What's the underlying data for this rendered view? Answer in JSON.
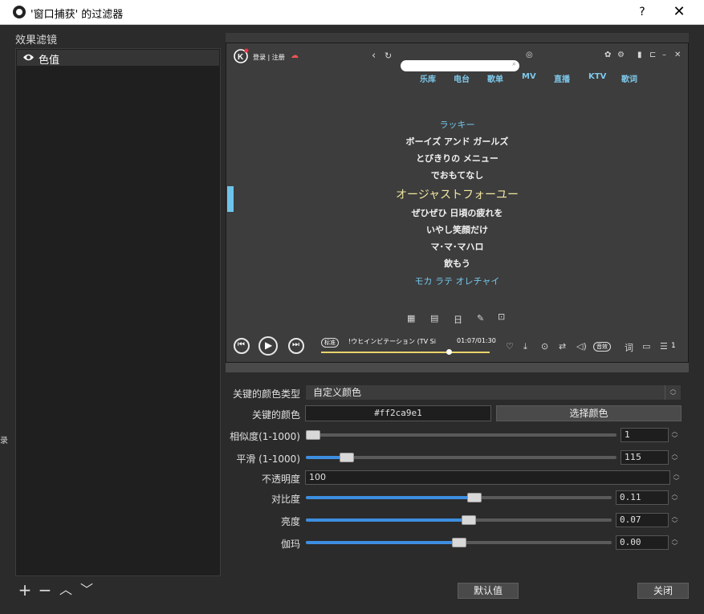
{
  "window": {
    "title": "'窗口捕获' 的过滤器",
    "help": "?",
    "close": "✕"
  },
  "filters": {
    "label": "效果滤镜",
    "items": [
      {
        "name": "色值"
      }
    ],
    "tools": [
      "+",
      "−",
      "︿",
      "﹀"
    ]
  },
  "preview": {
    "login": "登录 | 注册",
    "nav": [
      "乐库",
      "电台",
      "歌单",
      "MV",
      "直播",
      "KTV",
      "歌词"
    ],
    "lyrics": [
      "ラッキー",
      "ボーイズ アンド ガールズ",
      "とびきりの メニュー",
      "でおもてなし",
      "オージャストフォーユー",
      "ぜひぜひ 日頃の疲れを",
      "いやし笑顔だけ",
      "マ･マ･マハロ",
      "飲もう",
      "モカ ラテ オレチャイ"
    ],
    "song": "!ウヒインビテーション (TV Si",
    "time": "01:07/01:30",
    "quality": "标准",
    "effect": "音效",
    "queue_count": "1"
  },
  "props": {
    "key_color_type_label": "关键的颜色类型",
    "key_color_type_value": "自定义颜色",
    "key_color_label": "关键的颜色",
    "key_color_value": "#ff2ca9e1",
    "pick_color_button": "选择颜色",
    "similarity_label": "相似度(1-1000)",
    "similarity_value": "1",
    "smooth_label": "平滑 (1-1000)",
    "smooth_value": "115",
    "opacity_label": "不透明度",
    "opacity_value": "100",
    "contrast_label": "对比度",
    "contrast_value": "0.11",
    "brightness_label": "亮度",
    "brightness_value": "0.07",
    "gamma_label": "伽玛",
    "gamma_value": "0.00"
  },
  "sliders": {
    "similarity": 0.001,
    "smooth": 0.115,
    "contrast": 0.555,
    "brightness": 0.535,
    "gamma": 0.5
  },
  "buttons": {
    "defaults": "默认值",
    "close": "关闭"
  },
  "colors": {
    "accent": "#3d8ee0",
    "lyric_blue": "#74c6ea",
    "highlight": "#f0e6a0"
  }
}
